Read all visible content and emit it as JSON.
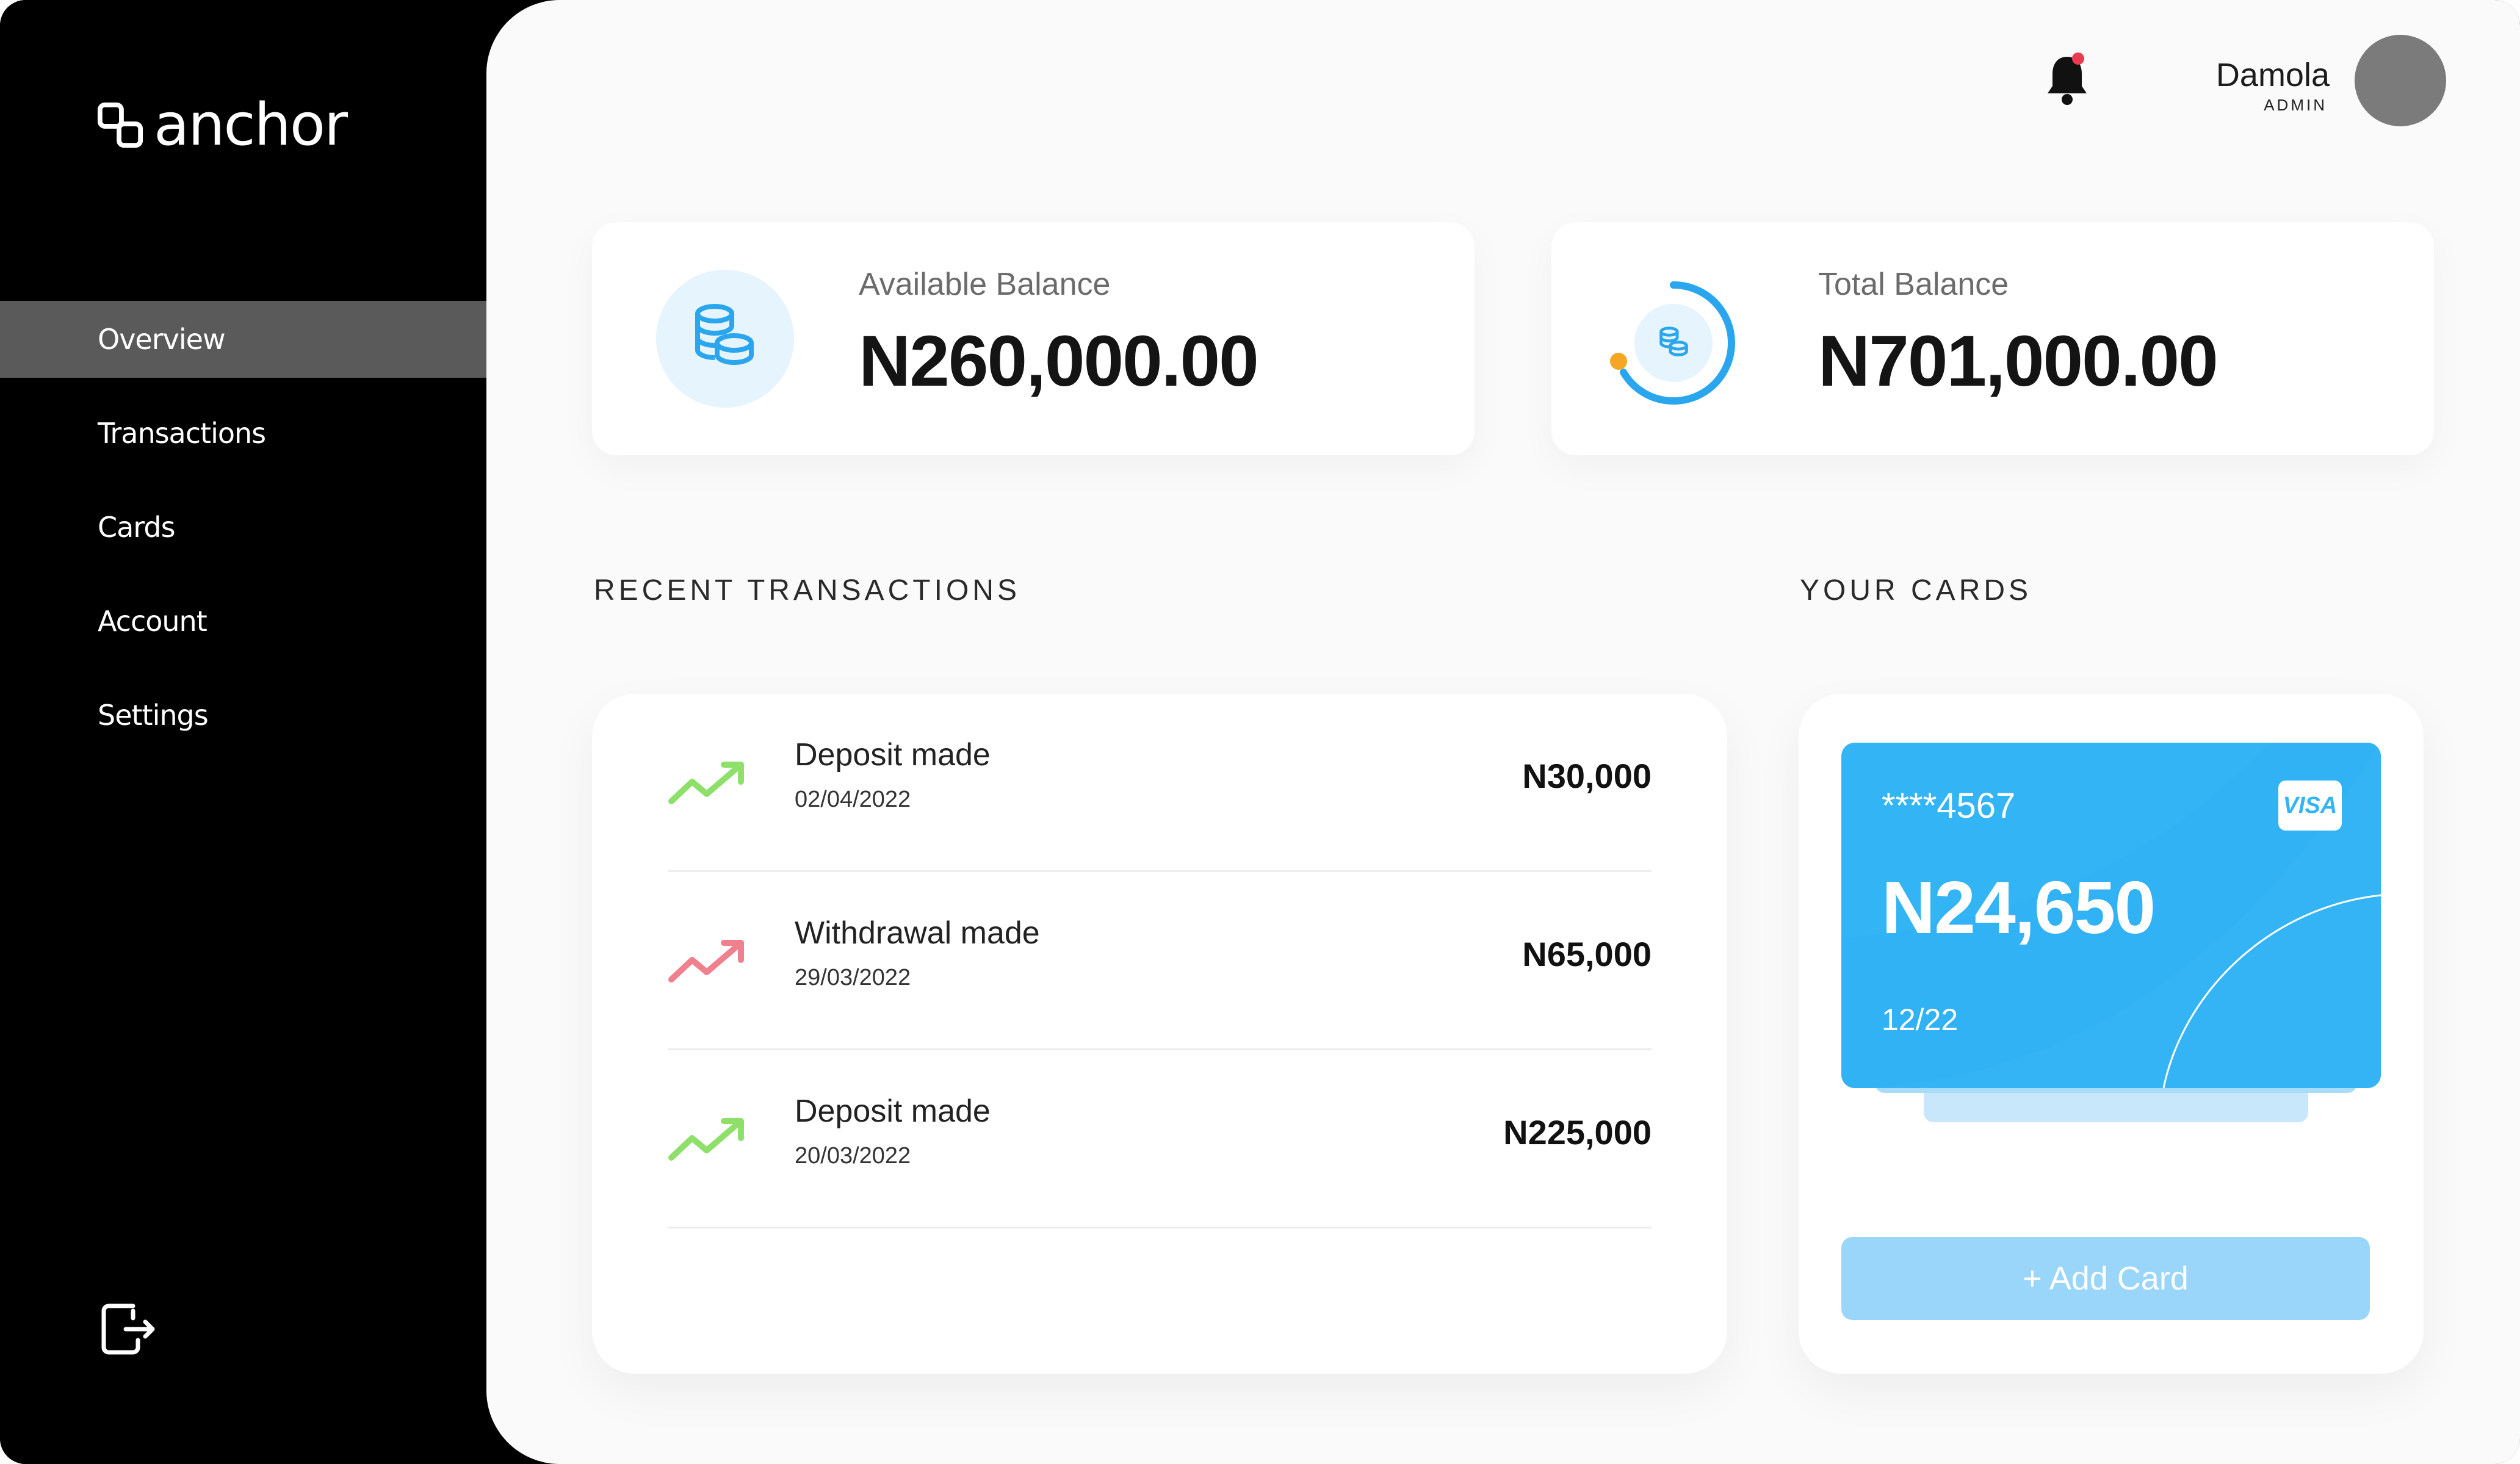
{
  "app": {
    "logo_text": "anchor"
  },
  "sidebar": {
    "items": [
      {
        "label": "Overview"
      },
      {
        "label": "Transactions"
      },
      {
        "label": "Cards"
      },
      {
        "label": "Account"
      },
      {
        "label": "Settings"
      }
    ],
    "active": "Overview"
  },
  "header": {
    "user_name": "Damola",
    "user_role": "ADMIN",
    "notification_badge": true
  },
  "balances": {
    "available": {
      "label": "Available Balance",
      "value": "N260,000.00"
    },
    "total": {
      "label": "Total Balance",
      "value": "N701,000.00"
    }
  },
  "recent": {
    "title": "RECENT TRANSACTIONS",
    "transactions": [
      {
        "title": "Deposit made",
        "date": "02/04/2022",
        "amount": "N30,000",
        "type": "deposit"
      },
      {
        "title": "Withdrawal made",
        "date": "29/03/2022",
        "amount": "N65,000",
        "type": "withdrawal"
      },
      {
        "title": "Deposit made",
        "date": "20/03/2022",
        "amount": "N225,000",
        "type": "deposit"
      }
    ]
  },
  "cards": {
    "title": "YOUR CARDS",
    "card": {
      "number": "****4567",
      "balance": "N24,650",
      "expiry": "12/22",
      "brand": "VISA"
    },
    "add_label": "+ Add Card"
  },
  "colors": {
    "accent": "#33b4f5",
    "deposit": "#8ee06b",
    "withdrawal": "#f0808d",
    "sidebar_bg": "#000000",
    "active_nav": "#5a5a5a",
    "notification_dot": "#ea3a50",
    "ring_dot": "#f5a623"
  },
  "icons": {
    "logo": "anchor-logo-icon",
    "bell": "bell-icon",
    "logout": "logout-icon",
    "coins": "coins-icon",
    "trend": "trend-up-icon"
  }
}
